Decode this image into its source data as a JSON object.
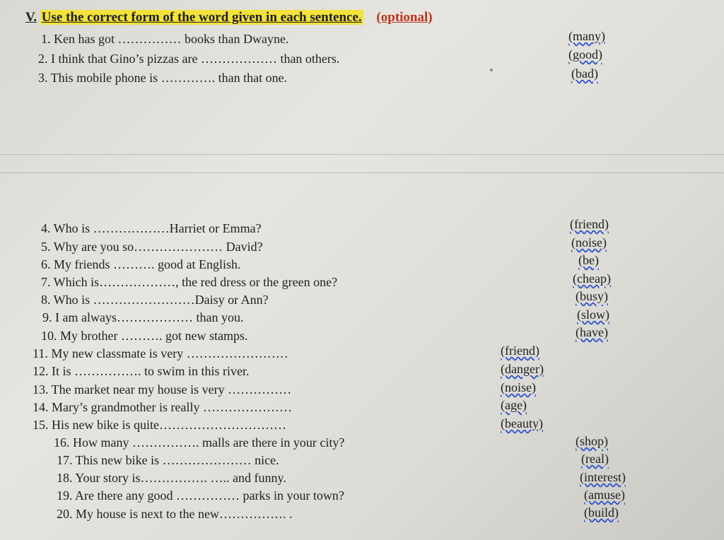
{
  "exercise": {
    "number": "V.",
    "title": "Use the correct form of the word given in each sentence.",
    "tag": "(optional)"
  },
  "items": [
    {
      "text": "1. Ken has got …………… books than Dwayne.",
      "hint": "(many)"
    },
    {
      "text": "2. I think that Gino’s pizzas are ……………… than others.",
      "hint": "(good)"
    },
    {
      "text": "3. This mobile phone is …………. than that one.",
      "hint": "(bad)"
    },
    {
      "text": "4. Who is ………………Harriet or Emma?",
      "hint": "(friend)"
    },
    {
      "text": "5. Why are you so………………… David?",
      "hint": "(noise)"
    },
    {
      "text": "6. My friends ………. good at English.",
      "hint": "(be)"
    },
    {
      "text": "7. Which is………………, the red dress or the green one?",
      "hint": "(cheap)"
    },
    {
      "text": "8. Who is ……………………Daisy or Ann?",
      "hint": "(busy)"
    },
    {
      "text": "9. I am always……………… than you.",
      "hint": "(slow)"
    },
    {
      "text": "10. My brother ………. got new stamps.",
      "hint": "(have)"
    },
    {
      "text": "11. My new classmate is very ……………………",
      "hint": "(friend)"
    },
    {
      "text": "12. It is ……………. to swim in this river.",
      "hint": "(danger)"
    },
    {
      "text": "13. The market near my house is very ……………",
      "hint": "(noise)"
    },
    {
      "text": "14. Mary’s grandmother is really …………………",
      "hint": "(age)"
    },
    {
      "text": "15. His new bike is quite…………………………",
      "hint": "(beauty)"
    },
    {
      "text": "16. How many ……………. malls are there in your city?",
      "hint": "(shop)"
    },
    {
      "text": "17. This new bike is ………………… nice.",
      "hint": "(real)"
    },
    {
      "text": "18. Your story is……………. ….. and funny.",
      "hint": "(interest)"
    },
    {
      "text": "19. Are there any good …………… parks in your town?",
      "hint": "(amuse)"
    },
    {
      "text": "20. My house is next to the new……………. .",
      "hint": "(build)"
    }
  ]
}
